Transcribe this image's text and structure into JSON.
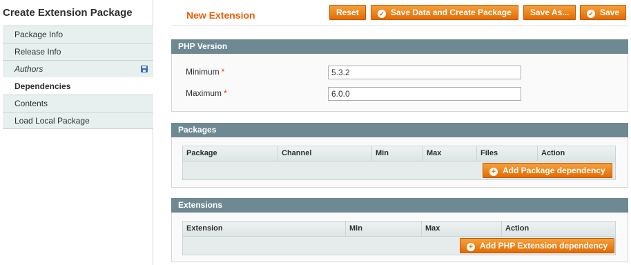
{
  "sidebar": {
    "title": "Create Extension Package",
    "items": [
      {
        "label": "Package Info"
      },
      {
        "label": "Release Info"
      },
      {
        "label": "Authors"
      },
      {
        "label": "Dependencies"
      },
      {
        "label": "Contents"
      },
      {
        "label": "Load Local Package"
      }
    ]
  },
  "header": {
    "title": "New Extension",
    "buttons": {
      "reset": "Reset",
      "save_create": "Save Data and Create Package",
      "save_as": "Save As...",
      "save": "Save"
    }
  },
  "php_version": {
    "title": "PHP Version",
    "minimum_label": "Minimum",
    "minimum_value": "5.3.2",
    "maximum_label": "Maximum",
    "maximum_value": "6.0.0",
    "required_mark": "*"
  },
  "packages": {
    "title": "Packages",
    "columns": [
      "Package",
      "Channel",
      "Min",
      "Max",
      "Files",
      "Action"
    ],
    "add_button": "Add Package dependency"
  },
  "extensions": {
    "title": "Extensions",
    "columns": [
      "Extension",
      "Min",
      "Max",
      "Action"
    ],
    "add_button": "Add PHP Extension dependency"
  },
  "colors": {
    "accent": "#eb5e00",
    "button": "#f18200",
    "section_header": "#6f8992",
    "tab_background": "#e7efef"
  },
  "icons": {
    "authors_tab": "save-icon",
    "save_buttons": "check-icon",
    "add_buttons": "plus-icon"
  }
}
